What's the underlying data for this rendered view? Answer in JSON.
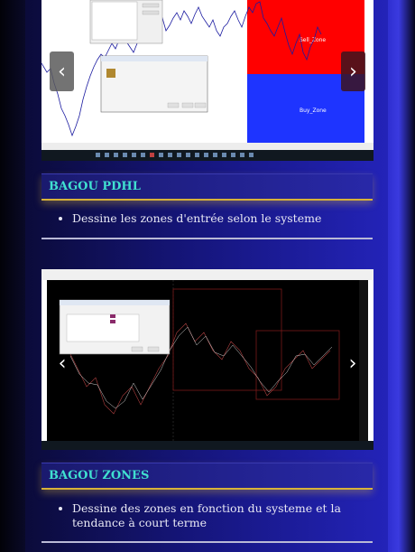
{
  "products": [
    {
      "title": "BAGOU PDHL",
      "description": "Dessine les zones d'entrée selon le systeme",
      "screenshot": {
        "sell_zone_label": "Sell_Zone",
        "buy_zone_label": "Buy_Zone"
      }
    },
    {
      "title": "BAGOU ZONES",
      "description": "Dessine des zones en fonction du systeme et la tendance à court terme"
    }
  ],
  "carousel": {
    "prev_glyph": "‹",
    "next_glyph": "›"
  },
  "colors": {
    "sell_zone": "#ff0000",
    "buy_zone": "#1e34ff",
    "title_text": "#40e0d0",
    "gold": "#d7b23a"
  }
}
